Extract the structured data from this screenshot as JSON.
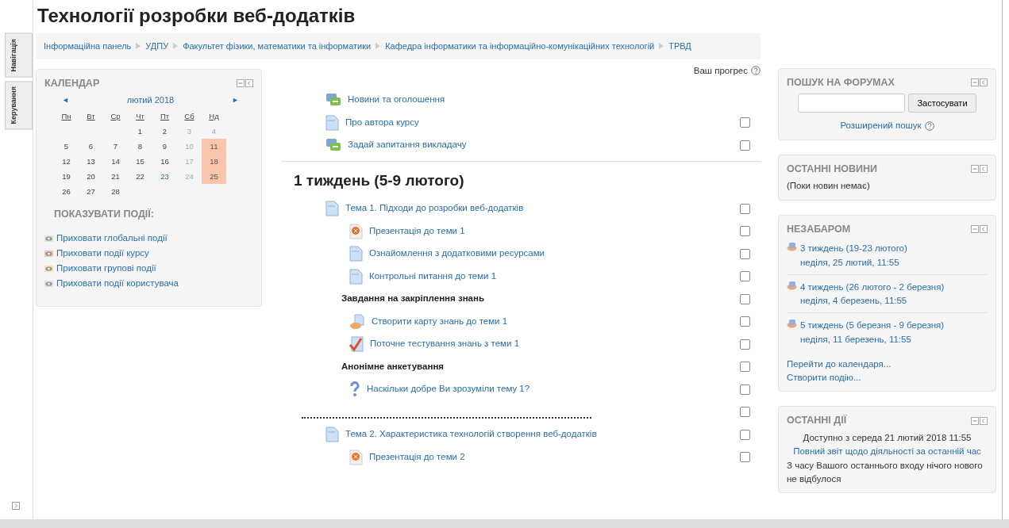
{
  "page_title": "Технології розробки веб-додатків",
  "side_tabs": [
    {
      "label": "Навігація"
    },
    {
      "label": "Керування"
    }
  ],
  "breadcrumb": [
    "Інформаційна панель",
    "УДПУ",
    "Факультет фізики, математики та інформатики",
    "Кафедра інформатики та інформаційно-комунікаційних технологій",
    "ТРВД"
  ],
  "calendar": {
    "title": "КАЛЕНДАР",
    "prev": "◄",
    "next": "►",
    "month": "лютий 2018",
    "weekdays": [
      "Пн",
      "Вт",
      "Ср",
      "Чт",
      "Пт",
      "Сб",
      "Нд"
    ],
    "weeks": [
      [
        {
          "day": "1",
          "kind": "normal"
        },
        {
          "day": "2",
          "kind": "normal"
        },
        {
          "day": "3",
          "kind": "weekend"
        },
        {
          "day": "4",
          "kind": "weekend"
        }
      ],
      [
        {
          "day": "5",
          "kind": "normal"
        },
        {
          "day": "6",
          "kind": "normal"
        },
        {
          "day": "7",
          "kind": "normal"
        },
        {
          "day": "8",
          "kind": "normal"
        },
        {
          "day": "9",
          "kind": "normal"
        },
        {
          "day": "10",
          "kind": "weekend"
        },
        {
          "day": "11",
          "kind": "event"
        }
      ],
      [
        {
          "day": "12",
          "kind": "normal"
        },
        {
          "day": "13",
          "kind": "normal"
        },
        {
          "day": "14",
          "kind": "normal"
        },
        {
          "day": "15",
          "kind": "normal"
        },
        {
          "day": "16",
          "kind": "normal"
        },
        {
          "day": "17",
          "kind": "weekend"
        },
        {
          "day": "18",
          "kind": "event"
        }
      ],
      [
        {
          "day": "19",
          "kind": "normal"
        },
        {
          "day": "20",
          "kind": "normal"
        },
        {
          "day": "21",
          "kind": "normal"
        },
        {
          "day": "22",
          "kind": "normal"
        },
        {
          "day": "23",
          "kind": "today"
        },
        {
          "day": "24",
          "kind": "weekend"
        },
        {
          "day": "25",
          "kind": "event"
        }
      ],
      [
        {
          "day": "26",
          "kind": "normal"
        },
        {
          "day": "27",
          "kind": "normal"
        },
        {
          "day": "28",
          "kind": "normal"
        }
      ]
    ],
    "events_heading": "ПОКАЗУВАТИ ПОДІЇ:",
    "event_filters": [
      {
        "label": "Приховати глобальні події",
        "color": "#d3ecc8"
      },
      {
        "label": "Приховати події курсу",
        "color": "#f6c4b0"
      },
      {
        "label": "Приховати групові події",
        "color": "#fbe3a8"
      },
      {
        "label": "Приховати події користувача",
        "color": "#d9e2ea"
      }
    ]
  },
  "progress_label": "Ваш прогрес",
  "sections": [
    {
      "items": [
        {
          "kind": "forum",
          "label": "Новини та оголошення"
        },
        {
          "kind": "page",
          "label": "Про автора курсу",
          "completion": {
            "checked": false
          }
        },
        {
          "kind": "forum",
          "label": "Задай запитання викладачу",
          "completion": {
            "checked": false
          }
        }
      ]
    },
    {
      "title": "1 тиждень (5-9 лютого)",
      "items": [
        {
          "kind": "page",
          "label": "Тема 1. Підходи до розробки веб-додатків",
          "completion": {
            "checked": false
          },
          "children": [
            {
              "kind": "presentation",
              "label": "Презентація до теми 1",
              "completion": {
                "checked": false
              }
            },
            {
              "kind": "page",
              "label": "Ознайомлення з додатковими ресурсами",
              "completion": {
                "checked": false
              }
            },
            {
              "kind": "page",
              "label": "Контрольні питання до теми 1",
              "completion": {
                "checked": false
              }
            },
            {
              "kind": "label",
              "label": "Завдання на закріплення знань",
              "completion": {
                "checked": false
              }
            },
            {
              "kind": "assign",
              "label": "Створити карту знань до теми 1",
              "completion": {
                "checked": false
              }
            },
            {
              "kind": "quiz",
              "label": "Поточне тестування знань з теми 1",
              "completion": {
                "checked": false
              }
            },
            {
              "kind": "label",
              "label": "Анонімне анкетування",
              "completion": {
                "checked": false
              }
            },
            {
              "kind": "feedback",
              "label": "Наскільки добре Ви зрозуміли тему 1?",
              "completion": {
                "checked": false
              }
            }
          ]
        },
        {
          "kind": "divider",
          "completion": {
            "checked": false
          }
        },
        {
          "kind": "page",
          "label": "Тема 2. Характеристика технологій створення веб-додатків",
          "completion": {
            "checked": false
          },
          "children": [
            {
              "kind": "presentation",
              "label": "Презентація до теми 2",
              "completion": {
                "checked": false
              }
            }
          ]
        }
      ]
    }
  ],
  "forum_search": {
    "title": "ПОШУК НА ФОРУМАХ",
    "button": "Застосувати",
    "advanced": "Розширений пошук"
  },
  "latest_news": {
    "title": "ОСТАННІ НОВИНИ",
    "text": "(Поки новин немає)"
  },
  "upcoming": {
    "title": "НЕЗАБАРОМ",
    "events": [
      {
        "name": "3 тиждень (19-23 лютого)",
        "date": "неділя, 25 лютий, 11:55"
      },
      {
        "name": "4 тиждень (26 лютого - 2 березня)",
        "date": "неділя, 4 березень, 11:55"
      },
      {
        "name": "5 тиждень (5 березня - 9 березня)",
        "date": "неділя, 11 березень, 11:55"
      }
    ],
    "links": [
      "Перейти до календаря...",
      "Створити подію..."
    ]
  },
  "recent_activity": {
    "title": "ОСТАННІ ДІЇ",
    "since": "Доступно з середа 21 лютий 2018 11:55",
    "report_link": "Повний звіт щодо діяльності за останній час",
    "message": "З часу Вашого останнього входу нічого нового не відбулося"
  }
}
